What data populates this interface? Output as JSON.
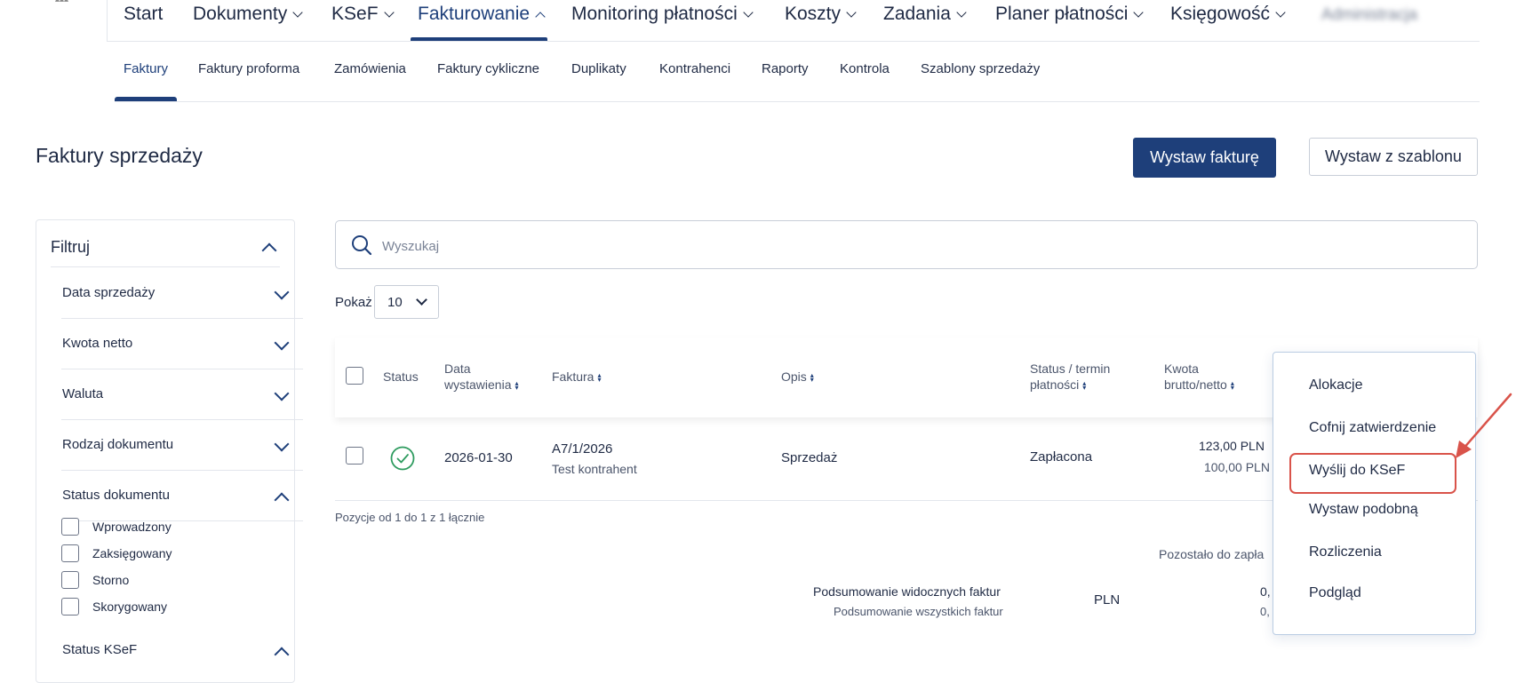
{
  "topnav": {
    "items": [
      {
        "label": "Start"
      },
      {
        "label": "Dokumenty"
      },
      {
        "label": "KSeF"
      },
      {
        "label": "Fakturowanie"
      },
      {
        "label": "Monitoring płatności"
      },
      {
        "label": "Koszty"
      },
      {
        "label": "Zadania"
      },
      {
        "label": "Planer płatności"
      },
      {
        "label": "Księgowość"
      },
      {
        "label": "Administracja"
      }
    ]
  },
  "subnav": {
    "items": [
      {
        "label": "Faktury"
      },
      {
        "label": "Faktury proforma"
      },
      {
        "label": "Zamówienia"
      },
      {
        "label": "Faktury cykliczne"
      },
      {
        "label": "Duplikaty"
      },
      {
        "label": "Kontrahenci"
      },
      {
        "label": "Raporty"
      },
      {
        "label": "Kontrola"
      },
      {
        "label": "Szablony sprzedaży"
      }
    ]
  },
  "page": {
    "title": "Faktury sprzedaży",
    "primary_button": "Wystaw fakturę",
    "secondary_button": "Wystaw z szablonu"
  },
  "filter": {
    "title": "Filtruj",
    "rows": [
      "Data sprzedaży",
      "Kwota netto",
      "Waluta",
      "Rodzaj dokumentu",
      "Status dokumentu"
    ],
    "status_options": [
      "Wprowadzony",
      "Zaksięgowany",
      "Storno",
      "Skorygowany"
    ],
    "ksef_label": "Status KSeF"
  },
  "search": {
    "placeholder": "Wyszukaj"
  },
  "page_size": {
    "label": "Pokaż",
    "value": "10"
  },
  "table": {
    "headers": {
      "status": "Status",
      "date_line1": "Data",
      "date_line2": "wystawienia",
      "invoice": "Faktura",
      "description": "Opis",
      "payment_line1": "Status / termin",
      "payment_line2": "płatności",
      "amount_line1": "Kwota",
      "amount_line2": "brutto/netto"
    },
    "rows": [
      {
        "date": "2026-01-30",
        "invoice": "A7/1/2026",
        "contractor": "Test kontrahent",
        "description": "Sprzedaż",
        "payment_status": "Zapłacona",
        "gross": "123,00 PLN",
        "net": "100,00 PLN"
      }
    ],
    "pager": "Pozycje od 1 do 1 z 1 łącznie"
  },
  "summary": {
    "remaining_label": "Pozostało do zapła",
    "visible_label": "Podsumowanie widocznych faktur",
    "all_label": "Podsumowanie wszystkich faktur",
    "currency": "PLN",
    "visible_value": "0,",
    "all_value": "0,"
  },
  "context_menu": {
    "items": [
      "Alokacje",
      "Cofnij zatwierdzenie",
      "Wyślij do KSeF",
      "Wystaw podobną",
      "Rozliczenia",
      "Podgląd"
    ]
  },
  "colors": {
    "brand": "#1e3f7a",
    "success": "#2e9b5f",
    "annotation": "#d9534a"
  }
}
